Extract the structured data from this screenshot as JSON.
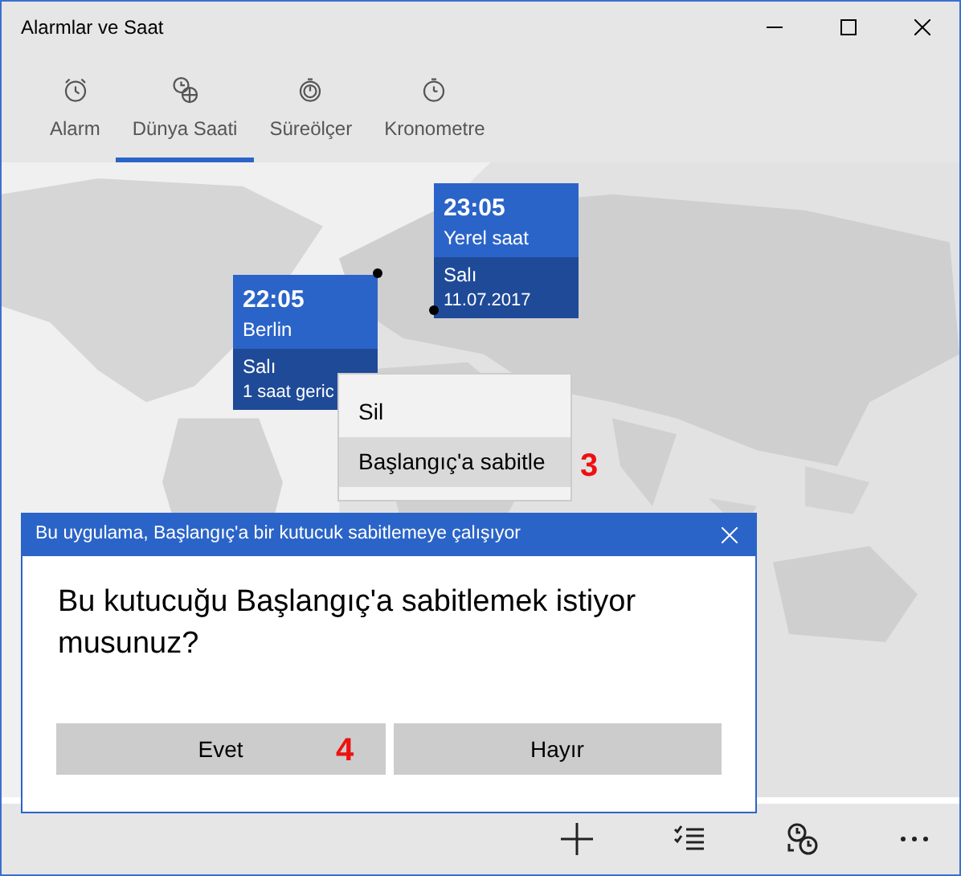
{
  "window": {
    "title": "Alarmlar ve Saat"
  },
  "tabs": [
    {
      "label": "Alarm",
      "selected": false
    },
    {
      "label": "Dünya Saati",
      "selected": true
    },
    {
      "label": "Süreölçer",
      "selected": false
    },
    {
      "label": "Kronometre",
      "selected": false
    }
  ],
  "clocks": [
    {
      "time": "23:05",
      "place": "Yerel saat",
      "day": "Salı",
      "detail": "11.07.2017"
    },
    {
      "time": "22:05",
      "place": "Berlin",
      "day": "Salı",
      "detail": "1 saat geric"
    }
  ],
  "context_menu": {
    "items": [
      {
        "label": "Sil",
        "selected": false
      },
      {
        "label": "Başlangıç'a sabitle",
        "selected": true
      }
    ],
    "step": "3"
  },
  "dialog": {
    "title": "Bu uygulama, Başlangıç'a bir kutucuk sabitlemeye çalışıyor",
    "question": "Bu kutucuğu Başlangıç'a sabitlemek istiyor musunuz?",
    "buttons": [
      {
        "label": "Evet",
        "step": "4"
      },
      {
        "label": "Hayır"
      }
    ]
  }
}
